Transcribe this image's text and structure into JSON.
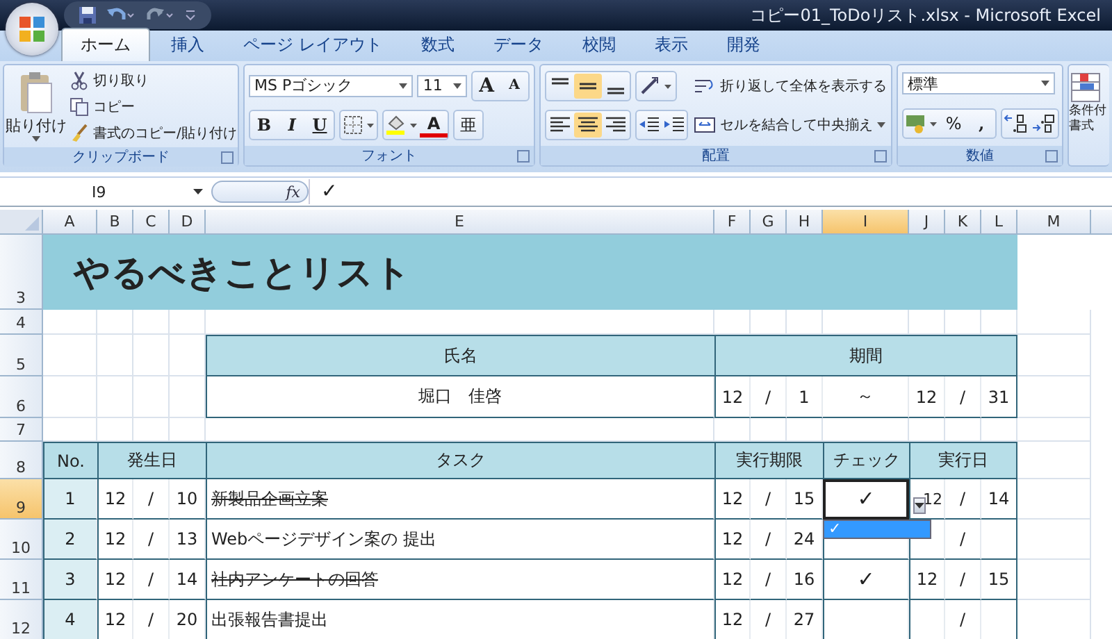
{
  "window": {
    "title": "コピー01_ToDoリスト.xlsx - Microsoft Excel"
  },
  "tabs": [
    {
      "label": "ホーム",
      "selected": true
    },
    {
      "label": "挿入",
      "selected": false
    },
    {
      "label": "ページ レイアウト",
      "selected": false
    },
    {
      "label": "数式",
      "selected": false
    },
    {
      "label": "データ",
      "selected": false
    },
    {
      "label": "校閲",
      "selected": false
    },
    {
      "label": "表示",
      "selected": false
    },
    {
      "label": "開発",
      "selected": false
    }
  ],
  "clipboard": {
    "label": "クリップボード",
    "paste": "貼り付け",
    "items": [
      {
        "kind": "cut",
        "label": "切り取り"
      },
      {
        "kind": "copy",
        "label": "コピー"
      },
      {
        "kind": "brush",
        "label": "書式のコピー/貼り付け"
      }
    ]
  },
  "font": {
    "label": "フォント",
    "name": "MS Pゴシック",
    "size": "11",
    "grow": "A",
    "shrink": "A",
    "bold": "B",
    "italic": "I",
    "underline": "U",
    "font_color_label": "A",
    "phonetic": "亜"
  },
  "alignment": {
    "label": "配置",
    "vertical": [
      {
        "kind": "top",
        "selected": false
      },
      {
        "kind": "middle",
        "selected": true
      },
      {
        "kind": "bottom",
        "selected": false
      }
    ],
    "horizontal": [
      {
        "kind": "left",
        "selected": false
      },
      {
        "kind": "center",
        "selected": true
      },
      {
        "kind": "right",
        "selected": false
      }
    ],
    "wrap": "折り返して全体を表示する",
    "merge": "セルを結合して中央揃え"
  },
  "number": {
    "label": "数値",
    "format": "標準",
    "percent": "%",
    "comma": ","
  },
  "styles": {
    "lines": [
      "条件付",
      "書式"
    ]
  },
  "formula_bar": {
    "name_box": "I9",
    "fx": "fx",
    "value": "✓"
  },
  "sheet": {
    "columns": [
      {
        "label": "A",
        "selected": false
      },
      {
        "label": "B",
        "selected": false
      },
      {
        "label": "C",
        "selected": false
      },
      {
        "label": "D",
        "selected": false
      },
      {
        "label": "E",
        "selected": false
      },
      {
        "label": "F",
        "selected": false
      },
      {
        "label": "G",
        "selected": false
      },
      {
        "label": "H",
        "selected": false
      },
      {
        "label": "I",
        "selected": true
      },
      {
        "label": "J",
        "selected": false
      },
      {
        "label": "K",
        "selected": false
      },
      {
        "label": "L",
        "selected": false
      },
      {
        "label": "M",
        "selected": false
      }
    ],
    "rows": [
      {
        "label": "3",
        "selected": false
      },
      {
        "label": "4",
        "selected": false
      },
      {
        "label": "5",
        "selected": false
      },
      {
        "label": "6",
        "selected": false
      },
      {
        "label": "7",
        "selected": false
      },
      {
        "label": "8",
        "selected": false
      },
      {
        "label": "9",
        "selected": true
      },
      {
        "label": "10",
        "selected": false
      },
      {
        "label": "11",
        "selected": false
      },
      {
        "label": "12",
        "selected": false
      }
    ],
    "title": "やるべきことリスト",
    "info": {
      "name_label": "氏名",
      "period_label": "期間",
      "name": "堀口　佳啓",
      "period": [
        "12",
        "/",
        "1",
        "～",
        "12",
        "/",
        "31"
      ]
    },
    "headers": [
      "No.",
      "発生日",
      "タスク",
      "実行期限",
      "チェック",
      "実行日"
    ],
    "tasks": [
      {
        "no": "1",
        "occurred": {
          "month": "12",
          "sep": "/",
          "day": "10"
        },
        "task": "新製品企画立案",
        "done": true,
        "deadline": {
          "month": "12",
          "sep": "/",
          "day": "15"
        },
        "check": "✓",
        "executed": {
          "month": "12",
          "sep": "/",
          "day": "14"
        }
      },
      {
        "no": "2",
        "occurred": {
          "month": "12",
          "sep": "/",
          "day": "13"
        },
        "task": "Webページデザイン案の 提出",
        "done": false,
        "deadline": {
          "month": "12",
          "sep": "/",
          "day": "24"
        },
        "executed": {
          "sep": "/"
        }
      },
      {
        "no": "3",
        "occurred": {
          "month": "12",
          "sep": "/",
          "day": "14"
        },
        "task": "社内アンケートの回答",
        "done": true,
        "deadline": {
          "month": "12",
          "sep": "/",
          "day": "16"
        },
        "check": "✓",
        "executed": {
          "month": "12",
          "sep": "/",
          "day": "15"
        }
      },
      {
        "no": "4",
        "occurred": {
          "month": "12",
          "sep": "/",
          "day": "20"
        },
        "task": "出張報告書提出",
        "done": false,
        "deadline": {
          "month": "12",
          "sep": "/",
          "day": "27"
        },
        "executed": {
          "sep": "/"
        }
      }
    ],
    "dropdown": {
      "options": [
        {
          "label": "✓",
          "selected": true
        }
      ]
    }
  }
}
